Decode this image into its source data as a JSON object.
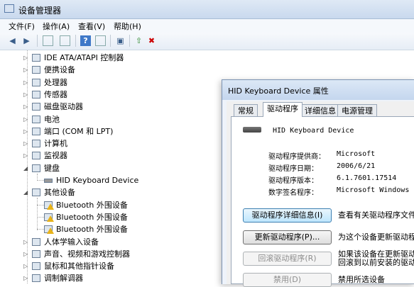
{
  "window": {
    "title": "设备管理器"
  },
  "menu": [
    {
      "label": "文件(F)"
    },
    {
      "label": "操作(A)"
    },
    {
      "label": "查看(V)"
    },
    {
      "label": "帮助(H)"
    }
  ],
  "toolbar": {
    "icons": [
      "back-arrow-icon",
      "forward-arrow-icon",
      "show-hide-tree-icon",
      "properties-icon",
      "help-icon",
      "console-tree-icon",
      "scan-hardware-icon",
      "update-driver-icon",
      "uninstall-icon"
    ]
  },
  "tree": {
    "items": [
      {
        "label": "IDE ATA/ATAPI 控制器",
        "level": 1,
        "expanded": false
      },
      {
        "label": "便携设备",
        "level": 1,
        "expanded": false
      },
      {
        "label": "处理器",
        "level": 1,
        "expanded": false
      },
      {
        "label": "传感器",
        "level": 1,
        "expanded": false
      },
      {
        "label": "磁盘驱动器",
        "level": 1,
        "expanded": false
      },
      {
        "label": "电池",
        "level": 1,
        "expanded": false
      },
      {
        "label": "端口 (COM 和 LPT)",
        "level": 1,
        "expanded": false
      },
      {
        "label": "计算机",
        "level": 1,
        "expanded": false
      },
      {
        "label": "监视器",
        "level": 1,
        "expanded": false
      },
      {
        "label": "键盘",
        "level": 1,
        "expanded": true
      },
      {
        "label": "HID Keyboard Device",
        "level": 2
      },
      {
        "label": "其他设备",
        "level": 1,
        "expanded": true
      },
      {
        "label": "Bluetooth 外围设备",
        "level": 2,
        "warning": true
      },
      {
        "label": "Bluetooth 外围设备",
        "level": 2,
        "warning": true
      },
      {
        "label": "Bluetooth 外围设备",
        "level": 2,
        "warning": true
      },
      {
        "label": "人体学输入设备",
        "level": 1,
        "expanded": false
      },
      {
        "label": "声音、视频和游戏控制器",
        "level": 1,
        "expanded": false
      },
      {
        "label": "鼠标和其他指针设备",
        "level": 1,
        "expanded": false
      },
      {
        "label": "调制解调器",
        "level": 1,
        "expanded": false
      }
    ]
  },
  "dialog": {
    "title": "HID Keyboard Device 属性",
    "tabs": [
      {
        "label": "常规"
      },
      {
        "label": "驱动程序",
        "active": true
      },
      {
        "label": "详细信息"
      },
      {
        "label": "电源管理"
      }
    ],
    "device_name": "HID Keyboard Device",
    "props": [
      {
        "key": "驱动程序提供商：",
        "value": "Microsoft"
      },
      {
        "key": "驱动程序日期：",
        "value": "2006/6/21"
      },
      {
        "key": "驱动程序版本：",
        "value": "6.1.7601.17514"
      },
      {
        "key": "数字签名程序：",
        "value": "Microsoft Windows"
      }
    ],
    "buttons": [
      {
        "label": "驱动程序详细信息(I)",
        "desc1": "查看有关驱动程序文件的详",
        "desc2": "",
        "state": "focus"
      },
      {
        "label": "更新驱动程序(P)...",
        "desc1": "为这个设备更新驱动程序",
        "desc2": "",
        "state": "normal"
      },
      {
        "label": "回滚驱动程序(R)",
        "desc1": "如果该设备在更新驱动程序",
        "desc2": "回滚到以前安装的驱动程序",
        "state": "disabled"
      },
      {
        "label": "禁用(D)",
        "desc1": "禁用所选设备",
        "desc2": "",
        "state": "disabled"
      }
    ]
  }
}
